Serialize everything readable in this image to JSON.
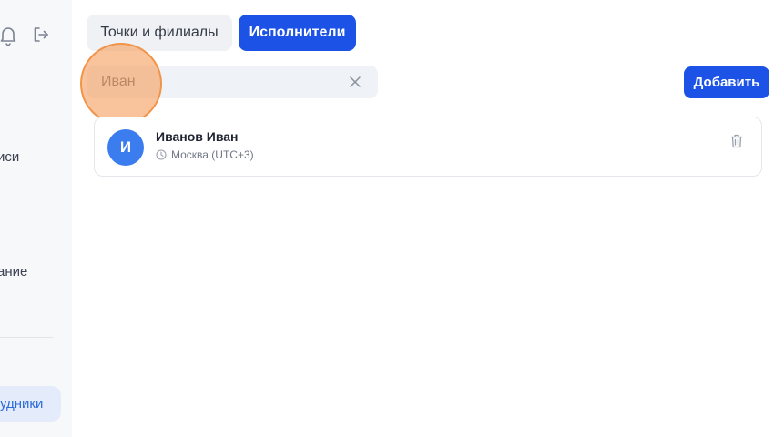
{
  "sidebar": {
    "icons": [
      "bell-icon",
      "logout-icon"
    ],
    "item_partial_1": "иси",
    "item_partial_2": "ание",
    "active_item_partial": "удники"
  },
  "tabs": [
    {
      "label": "Точки и филиалы",
      "active": false
    },
    {
      "label": "Исполнители",
      "active": true
    }
  ],
  "search": {
    "value": "Иван",
    "clear_icon": "close-icon"
  },
  "toolbar": {
    "add_label": "Добавить"
  },
  "executors": [
    {
      "initial": "И",
      "name": "Иванов Иван",
      "timezone": "Москва (UTC+3)",
      "delete_icon": "trash-icon"
    }
  ],
  "colors": {
    "accent": "#1c53e6",
    "avatar": "#3b7cef",
    "highlight": "#f5a05f"
  }
}
